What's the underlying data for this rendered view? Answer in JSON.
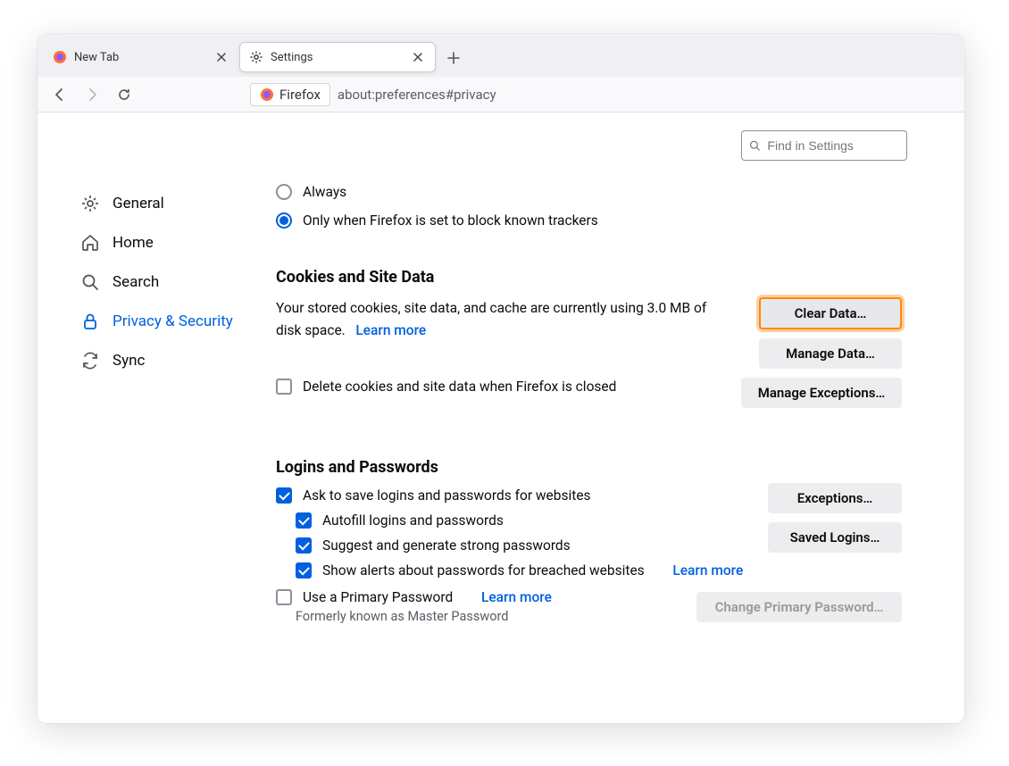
{
  "tabs": [
    {
      "label": "New Tab"
    },
    {
      "label": "Settings"
    }
  ],
  "urlbar": {
    "identity": "Firefox",
    "url": "about:preferences#privacy"
  },
  "search": {
    "placeholder": "Find in Settings"
  },
  "sidebar": [
    {
      "label": "General"
    },
    {
      "label": "Home"
    },
    {
      "label": "Search"
    },
    {
      "label": "Privacy & Security"
    },
    {
      "label": "Sync"
    }
  ],
  "trackers": {
    "always": "Always",
    "only": "Only when Firefox is set to block known trackers"
  },
  "cookies": {
    "heading": "Cookies and Site Data",
    "desc": "Your stored cookies, site data, and cache are currently using 3.0 MB of disk space.",
    "learn": "Learn more",
    "clear": "Clear Data…",
    "manage": "Manage Data…",
    "exceptions": "Manage Exceptions…",
    "delete_on_close": "Delete cookies and site data when Firefox is closed"
  },
  "logins": {
    "heading": "Logins and Passwords",
    "ask": "Ask to save logins and passwords for websites",
    "autofill": "Autofill logins and passwords",
    "suggest": "Suggest and generate strong passwords",
    "breach": "Show alerts about passwords for breached websites",
    "learn": "Learn more",
    "primary": "Use a Primary Password",
    "primary_learn": "Learn more",
    "exceptions": "Exceptions…",
    "saved": "Saved Logins…",
    "change": "Change Primary Password…",
    "formerly": "Formerly known as Master Password"
  }
}
